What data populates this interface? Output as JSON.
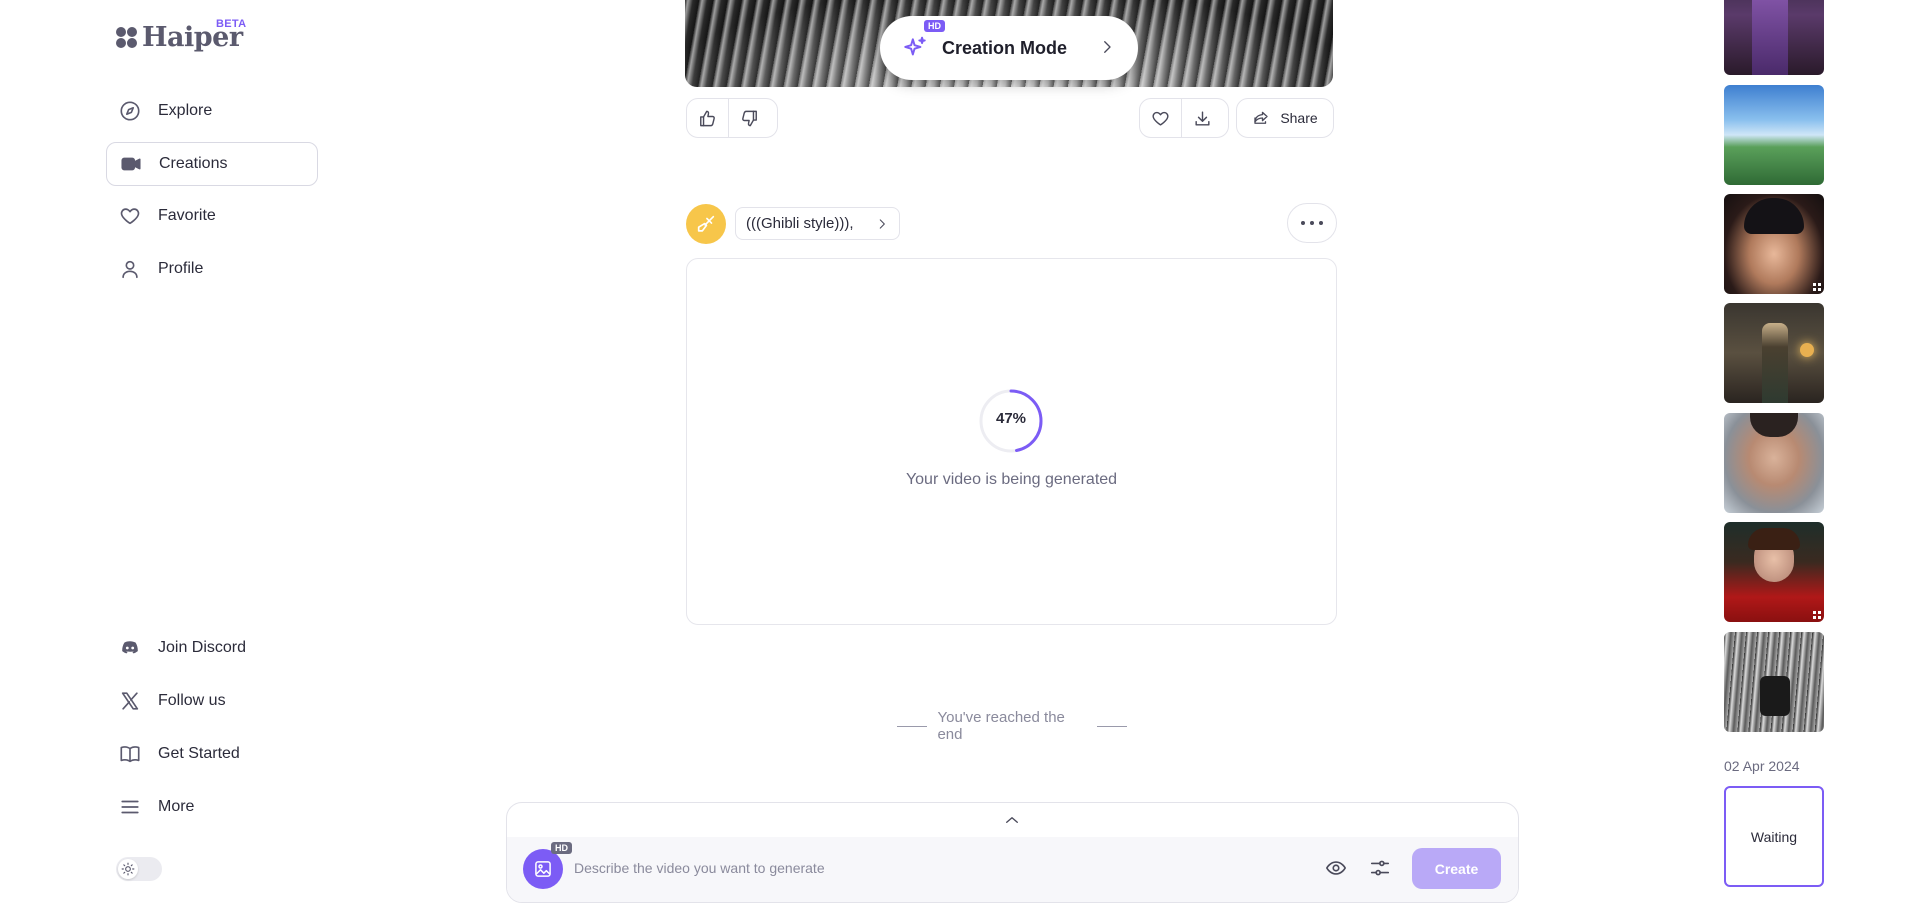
{
  "brand": {
    "name": "Haiper",
    "badge": "BETA"
  },
  "sidebar": {
    "nav": [
      {
        "label": "Explore",
        "icon": "compass-icon"
      },
      {
        "label": "Creations",
        "icon": "video-camera-icon",
        "active": true
      },
      {
        "label": "Favorite",
        "icon": "heart-icon"
      },
      {
        "label": "Profile",
        "icon": "user-icon"
      }
    ],
    "footer": [
      {
        "label": "Join Discord",
        "icon": "discord-icon"
      },
      {
        "label": "Follow us",
        "icon": "x-logo-icon"
      },
      {
        "label": "Get Started",
        "icon": "book-icon"
      },
      {
        "label": "More",
        "icon": "menu-icon"
      }
    ],
    "theme_toggle": "light"
  },
  "main": {
    "creation_mode": {
      "label": "Creation Mode",
      "badge": "HD"
    },
    "actions": {
      "share_label": "Share"
    },
    "prompt": {
      "text": "(((Ghibli style))),",
      "avatar_color": "#f7c64a"
    },
    "generation": {
      "progress_percent": 47,
      "progress_label": "47%",
      "status_text": "Your video is being generated"
    },
    "end_text": "You've reached the end"
  },
  "prompt_bar": {
    "hd_badge": "HD",
    "placeholder": "Describe the video you want to generate",
    "create_label": "Create"
  },
  "history": {
    "date": "02 Apr 2024",
    "waiting_label": "Waiting"
  },
  "colors": {
    "accent": "#7c5cf5",
    "accent_disabled": "#b9a9f7",
    "text": "#2b2b3a",
    "muted": "#8a8a9c"
  }
}
